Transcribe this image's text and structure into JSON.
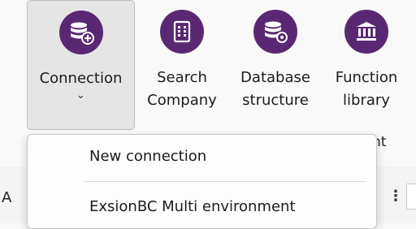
{
  "ribbon": {
    "buttons": [
      {
        "id": "connection",
        "lines": [
          "Connection"
        ],
        "chevron": "⌄",
        "icon": "database-add-icon",
        "active": true
      },
      {
        "id": "search-company",
        "lines": [
          "Search",
          "Company"
        ],
        "icon": "building-icon"
      },
      {
        "id": "database-structure",
        "lines": [
          "Database",
          "structure"
        ],
        "icon": "database-settings-icon"
      },
      {
        "id": "function-library",
        "lines": [
          "Function",
          "library"
        ],
        "icon": "library-icon"
      }
    ],
    "group_label_fragment": "nt"
  },
  "background": {
    "field_fragment": "A",
    "overflow_dots": "⋮"
  },
  "dropdown": {
    "items": [
      {
        "label": "New connection"
      },
      {
        "label": "ExsionBC Multi environment"
      }
    ]
  },
  "colors": {
    "icon_bg": "#5a2873",
    "active_button_bg": "#e5e5e5",
    "menu_bg": "#fdfdfd"
  }
}
